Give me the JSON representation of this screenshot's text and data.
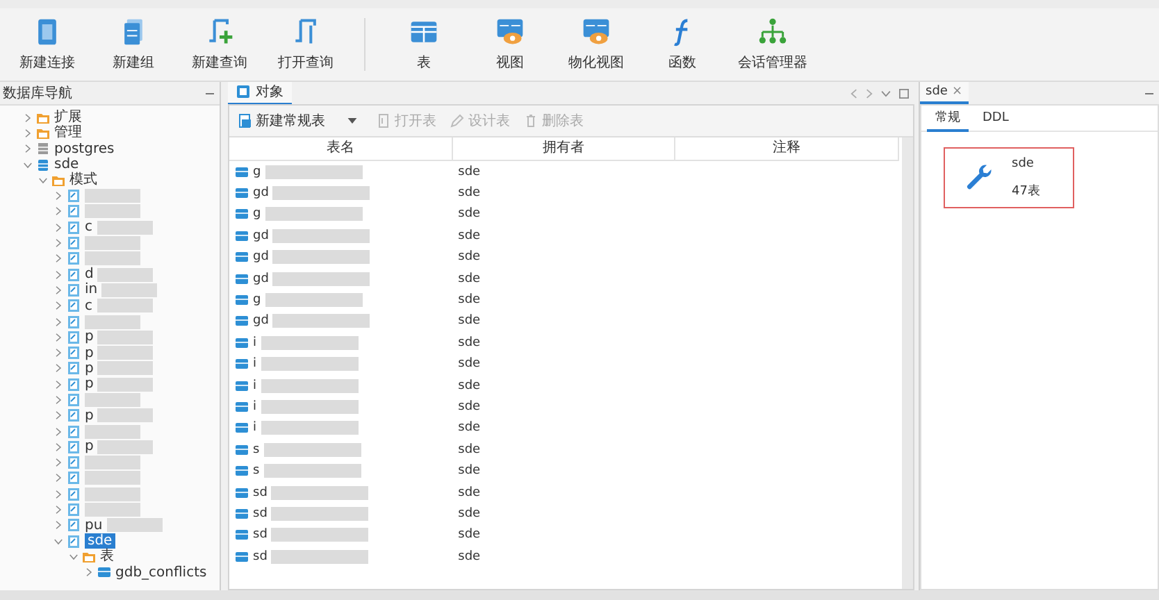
{
  "toolbar": [
    {
      "label": "新建连接",
      "kind": "connection",
      "separator_before": false
    },
    {
      "label": "新建组",
      "kind": "group",
      "separator_before": false
    },
    {
      "label": "新建查询",
      "kind": "new-query",
      "separator_before": false
    },
    {
      "label": "打开查询",
      "kind": "open-query",
      "separator_before": false
    },
    {
      "label": "表",
      "kind": "table",
      "separator_before": true
    },
    {
      "label": "视图",
      "kind": "view",
      "separator_before": false
    },
    {
      "label": "物化视图",
      "kind": "view",
      "separator_before": false
    },
    {
      "label": "函数",
      "kind": "function",
      "separator_before": false
    },
    {
      "label": "会话管理器",
      "kind": "sessions",
      "separator_before": false
    }
  ],
  "navigator": {
    "title": "数据库导航",
    "tree": [
      {
        "label": "扩展",
        "kind": "folder",
        "expanded": false,
        "selected": false
      },
      {
        "label": "管理",
        "kind": "folder",
        "expanded": false,
        "selected": false
      },
      {
        "label": "postgres",
        "kind": "database-off",
        "expanded": false,
        "selected": false
      },
      {
        "label": "sde",
        "kind": "database",
        "expanded": true,
        "selected": false,
        "children": [
          {
            "label": "模式",
            "kind": "folder",
            "expanded": true,
            "selected": false,
            "children": [
              {
                "kind": "schema",
                "expanded": false,
                "selected": false,
                "redacted": true
              },
              {
                "kind": "schema",
                "expanded": false,
                "selected": false,
                "redacted": true
              },
              {
                "label": "c",
                "kind": "schema",
                "expanded": false,
                "selected": false,
                "redacted": true
              },
              {
                "kind": "schema",
                "expanded": false,
                "selected": false,
                "redacted": true
              },
              {
                "kind": "schema",
                "expanded": false,
                "selected": false,
                "redacted": true
              },
              {
                "label": "d",
                "kind": "schema",
                "expanded": false,
                "selected": false,
                "redacted": true
              },
              {
                "label": "in",
                "kind": "schema",
                "expanded": false,
                "selected": false,
                "redacted": true
              },
              {
                "label": "c",
                "kind": "schema",
                "expanded": false,
                "selected": false,
                "redacted": true
              },
              {
                "kind": "schema",
                "expanded": false,
                "selected": false,
                "redacted": true
              },
              {
                "label": "p",
                "kind": "schema",
                "expanded": false,
                "selected": false,
                "redacted": true
              },
              {
                "label": "p",
                "kind": "schema",
                "expanded": false,
                "selected": false,
                "redacted": true
              },
              {
                "label": "p",
                "kind": "schema",
                "expanded": false,
                "selected": false,
                "redacted": true
              },
              {
                "label": "p",
                "kind": "schema",
                "expanded": false,
                "selected": false,
                "redacted": true
              },
              {
                "kind": "schema",
                "expanded": false,
                "selected": false,
                "redacted": true
              },
              {
                "label": "p",
                "kind": "schema",
                "expanded": false,
                "selected": false,
                "redacted": true
              },
              {
                "kind": "schema",
                "expanded": false,
                "selected": false,
                "redacted": true
              },
              {
                "label": "p",
                "kind": "schema",
                "expanded": false,
                "selected": false,
                "redacted": true
              },
              {
                "kind": "schema",
                "expanded": false,
                "selected": false,
                "redacted": true
              },
              {
                "kind": "schema",
                "expanded": false,
                "selected": false,
                "redacted": true
              },
              {
                "kind": "schema",
                "expanded": false,
                "selected": false,
                "redacted": true
              },
              {
                "kind": "schema",
                "expanded": false,
                "selected": false,
                "redacted": true
              },
              {
                "label": "pu",
                "kind": "schema",
                "expanded": false,
                "selected": false,
                "redacted": true
              },
              {
                "label": "sde",
                "kind": "schema",
                "expanded": true,
                "selected": true,
                "redacted": false,
                "children": [
                  {
                    "label": "表",
                    "kind": "folder",
                    "expanded": true,
                    "selected": false,
                    "children": [
                      {
                        "label": "gdb_conflicts",
                        "kind": "table",
                        "expanded": false,
                        "selected": false
                      }
                    ]
                  }
                ]
              }
            ]
          }
        ]
      }
    ]
  },
  "object_tab": {
    "label": "对象",
    "selected": true
  },
  "object_toolbar": [
    {
      "label": "新建常规表",
      "kind": "new-table",
      "disabled": false,
      "dropdown": true
    },
    {
      "label": "打开表",
      "kind": "open",
      "disabled": true,
      "dropdown": false
    },
    {
      "label": "设计表",
      "kind": "pencil",
      "disabled": true,
      "dropdown": false
    },
    {
      "label": "删除表",
      "kind": "trash",
      "disabled": true,
      "dropdown": false
    }
  ],
  "table": {
    "columns": [
      "表名",
      "拥有者",
      "注释"
    ],
    "rows": [
      {
        "name": "g",
        "owner": "sde"
      },
      {
        "name": "gd",
        "owner": "sde"
      },
      {
        "name": "g",
        "owner": "sde"
      },
      {
        "name": "gd",
        "owner": "sde"
      },
      {
        "name": "gd",
        "owner": "sde"
      },
      {
        "name": "gd",
        "owner": "sde"
      },
      {
        "name": "g",
        "owner": "sde"
      },
      {
        "name": "gd",
        "owner": "sde"
      },
      {
        "name": "i",
        "owner": "sde"
      },
      {
        "name": "i",
        "owner": "sde"
      },
      {
        "name": "i",
        "owner": "sde"
      },
      {
        "name": "i",
        "owner": "sde"
      },
      {
        "name": "i",
        "owner": "sde"
      },
      {
        "name": "s",
        "owner": "sde"
      },
      {
        "name": "s",
        "owner": "sde"
      },
      {
        "name": "sd",
        "owner": "sde"
      },
      {
        "name": "sd",
        "owner": "sde"
      },
      {
        "name": "sd",
        "owner": "sde"
      },
      {
        "name": "sd",
        "owner": "sde"
      }
    ]
  },
  "detail_panel": {
    "tab": "sde",
    "close": "×",
    "tabs": [
      {
        "label": "常规",
        "selected": true
      },
      {
        "label": "DDL",
        "selected": false
      }
    ],
    "name": "sde",
    "count": "47表"
  }
}
